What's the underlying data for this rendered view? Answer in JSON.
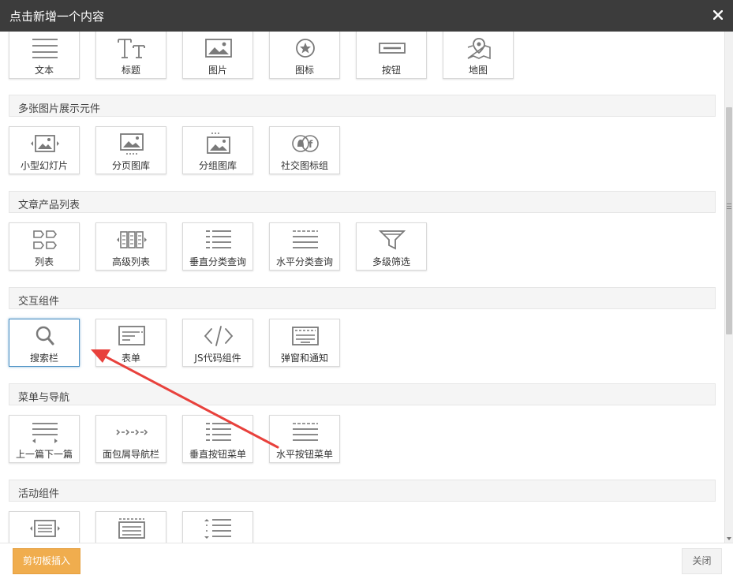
{
  "dialog": {
    "title": "点击新增一个内容",
    "close_icon": "close-icon"
  },
  "top_row": [
    {
      "label": "文本",
      "icon": "text-lines-icon"
    },
    {
      "label": "标题",
      "icon": "title-tt-icon"
    },
    {
      "label": "图片",
      "icon": "image-icon"
    },
    {
      "label": "图标",
      "icon": "star-circle-icon"
    },
    {
      "label": "按钮",
      "icon": "button-icon"
    },
    {
      "label": "地图",
      "icon": "map-pin-icon"
    }
  ],
  "sections": [
    {
      "title": "多张图片展示元件",
      "items": [
        {
          "label": "小型幻灯片",
          "icon": "slideshow-icon"
        },
        {
          "label": "分页图库",
          "icon": "paged-gallery-icon"
        },
        {
          "label": "分组图库",
          "icon": "grouped-gallery-icon"
        },
        {
          "label": "社交图标组",
          "icon": "social-icons-icon"
        }
      ]
    },
    {
      "title": "文章产品列表",
      "items": [
        {
          "label": "列表",
          "icon": "list-tags-icon"
        },
        {
          "label": "高级列表",
          "icon": "advanced-list-icon"
        },
        {
          "label": "垂直分类查询",
          "icon": "vertical-category-icon"
        },
        {
          "label": "水平分类查询",
          "icon": "horizontal-category-icon"
        },
        {
          "label": "多级筛选",
          "icon": "filter-funnel-icon"
        }
      ]
    },
    {
      "title": "交互组件",
      "items": [
        {
          "label": "搜索栏",
          "icon": "search-icon",
          "selected": true
        },
        {
          "label": "表单",
          "icon": "form-icon"
        },
        {
          "label": "JS代码组件",
          "icon": "code-brackets-icon"
        },
        {
          "label": "弹窗和通知",
          "icon": "popup-icon"
        }
      ]
    },
    {
      "title": "菜单与导航",
      "items": [
        {
          "label": "上一篇下一篇",
          "icon": "prev-next-icon"
        },
        {
          "label": "面包屑导航栏",
          "icon": "breadcrumb-arrows-icon"
        },
        {
          "label": "垂直按钮菜单",
          "icon": "vertical-menu-icon"
        },
        {
          "label": "水平按钮菜单",
          "icon": "horizontal-menu-icon"
        }
      ]
    },
    {
      "title": "活动组件",
      "items": [
        {
          "label": "",
          "icon": "activity-slider-icon"
        },
        {
          "label": "",
          "icon": "activity-panel-icon"
        },
        {
          "label": "",
          "icon": "activity-list-icon"
        }
      ]
    }
  ],
  "footer": {
    "clipboard_label": "剪切板插入",
    "close_label": "关闭"
  },
  "colors": {
    "titlebar": "#3c3c3c",
    "accent": "#f0ad4e",
    "selected": "#4a90c4",
    "arrow": "#e8413c",
    "icon": "#7a7a7a"
  }
}
